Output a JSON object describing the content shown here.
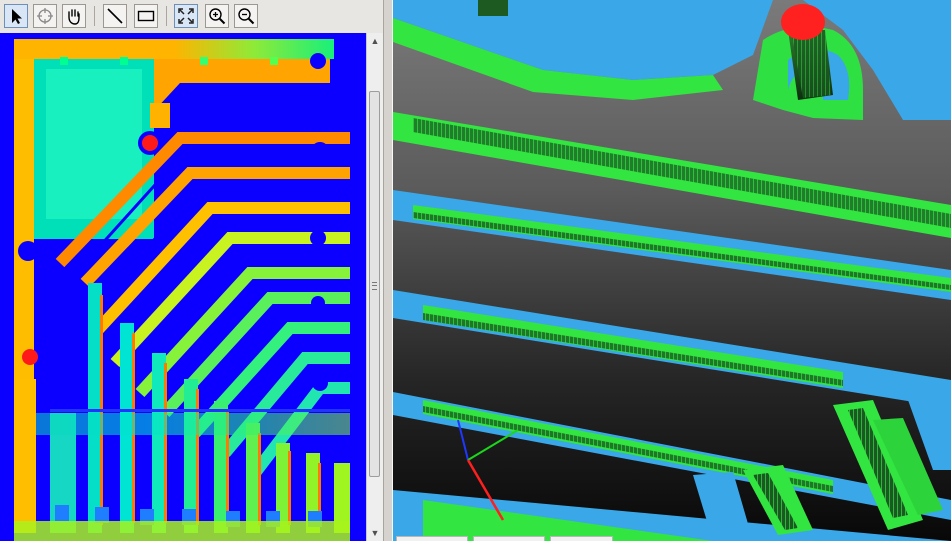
{
  "toolbar": {
    "tools": [
      {
        "name": "select-arrow-icon",
        "active": true
      },
      {
        "name": "target-crosshair-icon",
        "active": false
      },
      {
        "name": "pan-hand-icon",
        "active": false
      },
      {
        "name": "line-tool-icon",
        "active": false
      },
      {
        "name": "rectangle-tool-icon",
        "active": false
      },
      {
        "name": "fit-view-icon",
        "active": true
      },
      {
        "name": "zoom-in-icon",
        "active": false
      },
      {
        "name": "zoom-out-icon",
        "active": false
      }
    ]
  },
  "left_view": {
    "kind": "height-map-2d",
    "background": "#0b00ff",
    "markers": 2
  },
  "right_view": {
    "kind": "point-cloud-3d",
    "axes": {
      "x": "#1bd61b",
      "y": "#1f37ff",
      "z": "#ff1f1f"
    }
  },
  "colors": {
    "red_marker": "#ff1a1a",
    "green_band": "#29f02a",
    "cyan_band": "#33aef0",
    "orange_band": "#ff8c00"
  }
}
